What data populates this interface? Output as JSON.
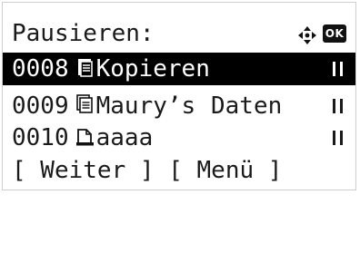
{
  "header": {
    "title": "Pausieren:",
    "nav_icon": "four-way-arrow-icon",
    "ok_label": "OK"
  },
  "jobs": [
    {
      "number": "0008",
      "icon": "copy-job-icon",
      "name": "Kopieren",
      "status_icon": "pause-icon",
      "selected": true
    },
    {
      "number": "0009",
      "icon": "print-job-icon",
      "name": "Maury’s",
      "extra": "Daten",
      "status_icon": "pause-icon",
      "selected": false
    },
    {
      "number": "0010",
      "icon": "document-icon",
      "name": "aaaa",
      "status_icon": "pause-icon",
      "selected": false
    }
  ],
  "softkeys": {
    "left": "[ Weiter ]",
    "right": "[ Menü ]"
  },
  "colors": {
    "highlight": "#000000",
    "text": "#1a1a1a",
    "background": "#ffffff"
  }
}
